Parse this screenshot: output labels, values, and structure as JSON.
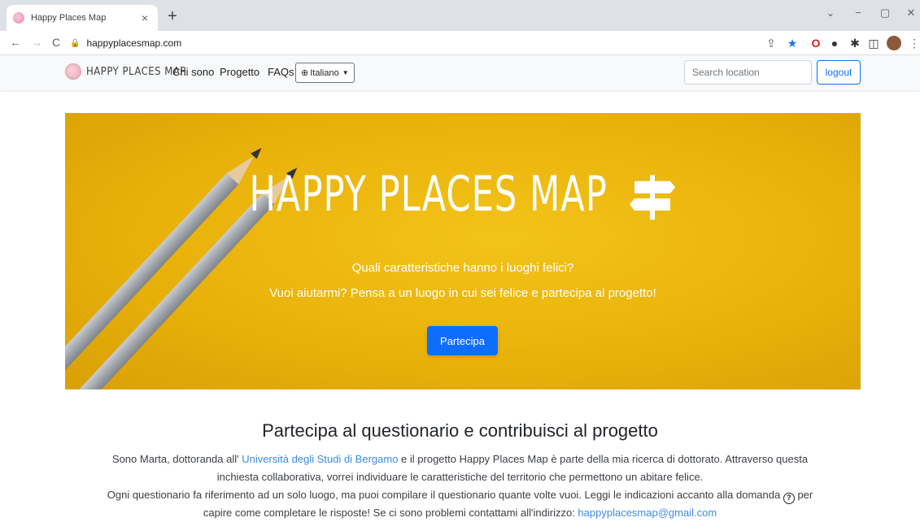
{
  "browser": {
    "tab_title": "Happy Places Map",
    "tab_close": "×",
    "new_tab": "+",
    "url": "happyplacesmap.com",
    "back": "←",
    "forward": "→",
    "reload": "C",
    "minimize": "−",
    "restore": "▢",
    "close": "✕",
    "dropdown": "⌄"
  },
  "navbar": {
    "brand": "HAPPY PLACES MAP",
    "links": [
      "Chi sono",
      "Progetto",
      "FAQs"
    ],
    "language": "Italiano",
    "search_placeholder": "Search location",
    "logout": "logout"
  },
  "hero": {
    "title": "HAPPY PLACES MAP",
    "question": "Quali caratteristiche hanno i luoghi felici?",
    "subtitle": "Vuoi aiutarmi? Pensa a un luogo in cui sei felice e partecipa al progetto!",
    "button": "Partecipa",
    "colors": {
      "background": "#f0bd12",
      "button": "#0d6efd"
    }
  },
  "content": {
    "title": "Partecipa al questionario e contribuisci al progetto",
    "p1_a": "Sono Marta, dottoranda all' ",
    "p1_link": "Università degli Studi di Bergamo",
    "p1_b": " e il progetto Happy Places Map è parte della mia ricerca di dottorato. Attraverso questa",
    "p1_c": "inchiesta collaborativa, vorrei individuare le caratteristiche del territorio che permettono un abitare felice.",
    "p2_a": "Ogni questionario fa riferimento ad un solo luogo, ma puoi compilare il questionario quante volte vuoi. Leggi le indicazioni accanto alla domanda ",
    "p2_icon": "?",
    "p2_b": " per",
    "p3_a": "capire come completare le risposte! Se ci sono problemi contattami all'indirizzo: ",
    "p3_email": "happyplacesmap@gmail.com"
  }
}
